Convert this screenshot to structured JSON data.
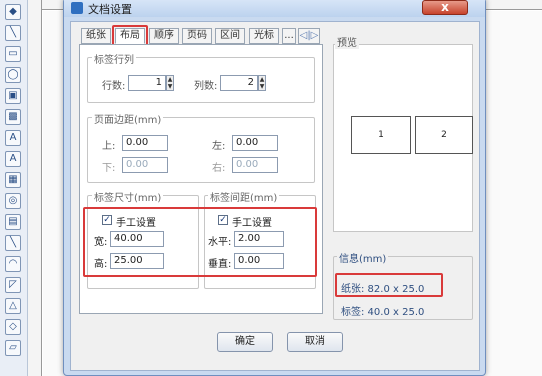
{
  "dialog": {
    "title": "文档设置",
    "close_label": "x",
    "tabs": [
      "纸张",
      "布局",
      "顺序",
      "页码",
      "区间",
      "光标",
      "...",
      "◁|▷"
    ],
    "active_tab": "布局"
  },
  "rows_cols": {
    "legend": "标签行列",
    "rows_label": "行数:",
    "rows_value": "1",
    "cols_label": "列数:",
    "cols_value": "2"
  },
  "margins": {
    "legend": "页面边距(mm)",
    "top_label": "上:",
    "top_value": "0.00",
    "left_label": "左:",
    "left_value": "0.00",
    "bottom_label": "下:",
    "bottom_value": "0.00",
    "right_label": "右:",
    "right_value": "0.00"
  },
  "label_size": {
    "legend": "标签尺寸(mm)",
    "manual_label": "手工设置",
    "width_label": "宽:",
    "width_value": "40.00",
    "height_label": "高:",
    "height_value": "25.00"
  },
  "label_gap": {
    "legend": "标签间距(mm)",
    "manual_label": "手工设置",
    "h_label": "水平:",
    "h_value": "2.00",
    "v_label": "垂直:",
    "v_value": "0.00"
  },
  "preview": {
    "legend": "预览",
    "cells": [
      "1",
      "2"
    ]
  },
  "info": {
    "legend": "信息(mm)",
    "paper": "纸张: 82.0 x 25.0",
    "label": "标签: 40.0 x 25.0"
  },
  "buttons": {
    "ok": "确定",
    "cancel": "取消"
  },
  "check_mark": "✓",
  "spin_up": "▲",
  "spin_down": "▼",
  "toolbar_icons": [
    "pointer-icon",
    "line-icon",
    "rect-icon",
    "ellipse-icon",
    "image-icon",
    "image2-icon",
    "text-icon",
    "richtext-icon",
    "barcode-icon",
    "qrcode-icon",
    "table-icon",
    "curve-icon",
    "arc-icon",
    "polygon-icon",
    "triangle-icon",
    "diamond-icon",
    "parallelogram-icon"
  ],
  "toolbar_glyphs": [
    "◆",
    "╲",
    "▭",
    "◯",
    "▣",
    "▩",
    "A",
    "A",
    "▦",
    "◎",
    "▤",
    "╲",
    "◠",
    "◸",
    "△",
    "◇",
    "▱"
  ],
  "accent_red": "#d93a3a"
}
